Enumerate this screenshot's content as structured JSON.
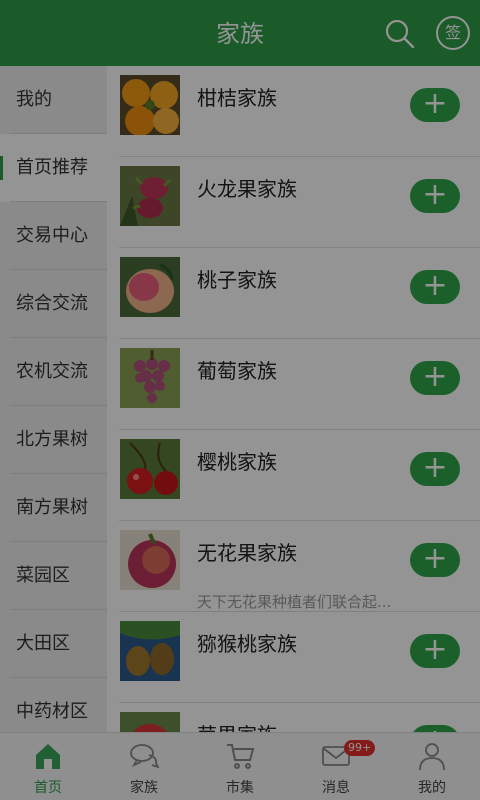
{
  "header": {
    "title": "家族",
    "search_icon": "search-icon",
    "sign_label": "签"
  },
  "sidebar": {
    "active_index": 1,
    "items": [
      {
        "label": "我的"
      },
      {
        "label": "首页推荐"
      },
      {
        "label": "交易中心"
      },
      {
        "label": "综合交流"
      },
      {
        "label": "农机交流"
      },
      {
        "label": "北方果树"
      },
      {
        "label": "南方果树"
      },
      {
        "label": "菜园区"
      },
      {
        "label": "大田区"
      },
      {
        "label": "中药材区"
      }
    ]
  },
  "families": [
    {
      "name": "柑桔家族",
      "desc": "",
      "image": "tangerine"
    },
    {
      "name": "火龙果家族",
      "desc": "",
      "image": "dragon-fruit"
    },
    {
      "name": "桃子家族",
      "desc": "",
      "image": "peach"
    },
    {
      "name": "葡萄家族",
      "desc": "",
      "image": "grape"
    },
    {
      "name": "樱桃家族",
      "desc": "",
      "image": "cherry"
    },
    {
      "name": "无花果家族",
      "desc": "天下无花果种植者们联合起...",
      "image": "fig"
    },
    {
      "name": "猕猴桃家族",
      "desc": "",
      "image": "kiwi"
    },
    {
      "name": "苹果家族",
      "desc": "",
      "image": "apple"
    }
  ],
  "add_label": "+",
  "tabbar": {
    "active_index": 0,
    "items": [
      {
        "label": "首页",
        "icon": "home-icon"
      },
      {
        "label": "家族",
        "icon": "chat-bubbles-icon"
      },
      {
        "label": "市集",
        "icon": "cart-icon"
      },
      {
        "label": "消息",
        "icon": "mail-icon",
        "badge": "99+"
      },
      {
        "label": "我的",
        "icon": "person-icon"
      }
    ]
  },
  "colors": {
    "brand_green": "#2e9e47",
    "badge_red": "#e52e2e",
    "overlay": "rgba(0,0,0,0.42)"
  }
}
